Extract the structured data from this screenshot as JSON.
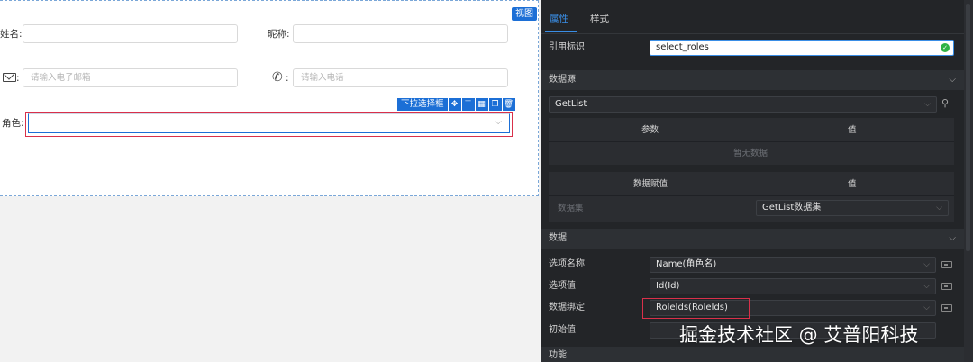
{
  "canvas": {
    "view_badge": "视图",
    "fields": {
      "name_label": "姓名:",
      "nickname_label": "昵称:",
      "email_placeholder": "请输入电子邮箱",
      "phone_placeholder": "请输入电话",
      "role_label": "角色:"
    },
    "select_toolbar": {
      "label": "下拉选择框",
      "buttons": [
        "✥",
        "⊤",
        "▦",
        "❐",
        "🗑"
      ]
    }
  },
  "panel": {
    "tabs": [
      "属性",
      "样式"
    ],
    "ref_id_label": "引用标识",
    "ref_id_value": "select_roles",
    "datasource": {
      "header": "数据源",
      "method": "GetList",
      "params_table": {
        "col1": "参数",
        "col2": "值",
        "empty": "暂无数据"
      },
      "assign_table": {
        "col1": "数据赋值",
        "col2": "值",
        "row_label": "数据集",
        "row_value": "GetList数据集"
      }
    },
    "data": {
      "header": "数据",
      "option_name_label": "选项名称",
      "option_name_value": "Name(角色名)",
      "option_value_label": "选项值",
      "option_value_value": "Id(Id)",
      "binding_label": "数据绑定",
      "binding_value": "RoleIds(RoleIds)",
      "initial_label": "初始值"
    },
    "feature_header": "功能"
  },
  "watermark": "掘金技术社区 @ 艾普阳科技",
  "colors": {
    "accent": "#3a8ee6",
    "highlight_red": "#d9304a",
    "badge_blue": "#1c6fd6",
    "check_green": "#2fb344"
  }
}
